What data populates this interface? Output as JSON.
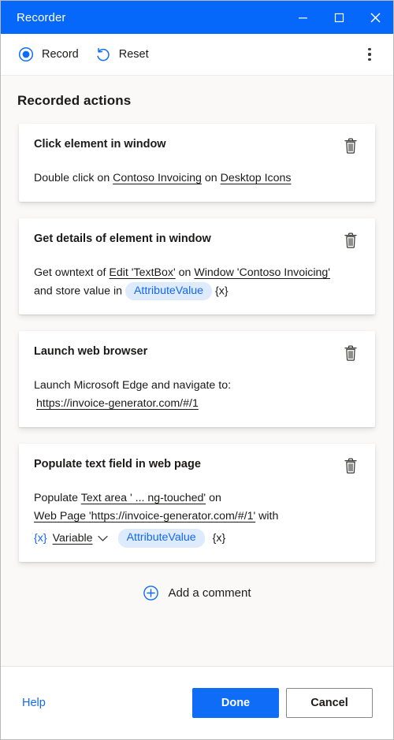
{
  "window": {
    "title": "Recorder",
    "controls": {
      "minimize": "minimize-icon",
      "maximize": "maximize-icon",
      "close": "close-icon"
    }
  },
  "toolbar": {
    "record_label": "Record",
    "reset_label": "Reset",
    "overflow_label": "More options"
  },
  "main": {
    "section_title": "Recorded actions",
    "cards": [
      {
        "title": "Click element in window",
        "line1_pre": "Double click on ",
        "link1": "Contoso Invoicing",
        "line1_mid": " on ",
        "link2": "Desktop Icons"
      },
      {
        "title": "Get details of element in window",
        "line1_pre": "Get owntext of ",
        "link1": "Edit 'TextBox'",
        "line1_mid": " on ",
        "link2": "Window 'Contoso Invoicing'",
        "line2_pre": "and store value in ",
        "pill": "AttributeValue",
        "var_token": "{x}"
      },
      {
        "title": "Launch web browser",
        "line1": "Launch Microsoft Edge and navigate to:",
        "link1": "https://invoice-generator.com/#/1"
      },
      {
        "title": "Populate text field in web page",
        "line1_pre": "Populate ",
        "link1": "Text area ' ...  ng-touched'",
        "line1_post": " on",
        "link2": "Web Page 'https://invoice-generator.com/#/1'",
        "line2_post": " with",
        "var_icon": "{x}",
        "variable_label": "Variable",
        "pill": "AttributeValue",
        "var_token": "{x}"
      }
    ],
    "add_comment_label": "Add a comment"
  },
  "footer": {
    "help_label": "Help",
    "done_label": "Done",
    "cancel_label": "Cancel"
  },
  "colors": {
    "titlebar_blue": "#0668fa",
    "accent_blue": "#0f6cf6",
    "pill_bg": "#deebfd",
    "pill_text": "#1268f5",
    "app_bg": "#faf9f8",
    "card_bg": "#ffffff"
  }
}
